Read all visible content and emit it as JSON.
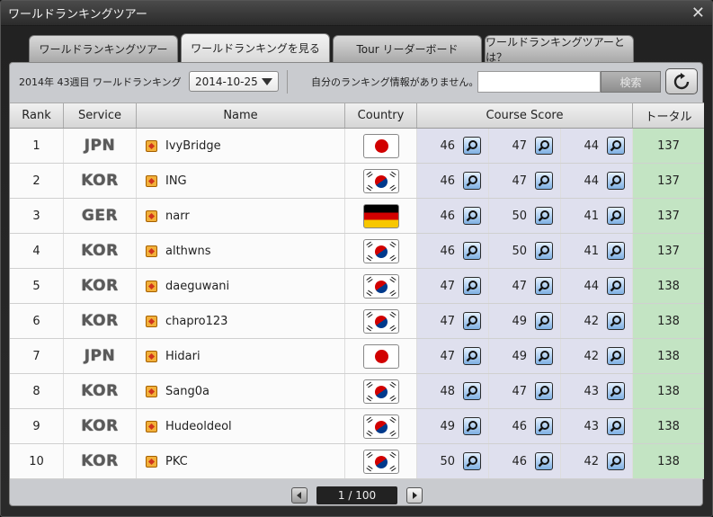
{
  "window": {
    "title": "ワールドランキングツアー"
  },
  "tabs": [
    {
      "label": "ワールドランキングツアー",
      "active": false
    },
    {
      "label": "ワールドランキングを見る",
      "active": true
    },
    {
      "label": "Tour リーダーボード",
      "active": false
    },
    {
      "label": "ワールドランキングツアーとは？",
      "active": false
    }
  ],
  "controls": {
    "week_label": "2014年 43週目 ワールドランキング",
    "selected_date": "2014-10-25",
    "my_info": "自分のランキング情報がありません。",
    "search_value": "",
    "search_label": "検索"
  },
  "headers": {
    "rank": "Rank",
    "service": "Service",
    "name": "Name",
    "country": "Country",
    "course_score": "Course Score",
    "total": "トータル"
  },
  "rows": [
    {
      "rank": "1",
      "service": "JPN",
      "name": "IvyBridge",
      "country": "jpn",
      "scores": [
        "46",
        "47",
        "44"
      ],
      "total": "137"
    },
    {
      "rank": "2",
      "service": "KOR",
      "name": "ING",
      "country": "kor",
      "scores": [
        "46",
        "47",
        "44"
      ],
      "total": "137"
    },
    {
      "rank": "3",
      "service": "GER",
      "name": "narr",
      "country": "ger",
      "scores": [
        "46",
        "50",
        "41"
      ],
      "total": "137"
    },
    {
      "rank": "4",
      "service": "KOR",
      "name": "althwns",
      "country": "kor",
      "scores": [
        "46",
        "50",
        "41"
      ],
      "total": "137"
    },
    {
      "rank": "5",
      "service": "KOR",
      "name": "daeguwani",
      "country": "kor",
      "scores": [
        "47",
        "47",
        "44"
      ],
      "total": "138"
    },
    {
      "rank": "6",
      "service": "KOR",
      "name": "chapro123",
      "country": "kor",
      "scores": [
        "47",
        "49",
        "42"
      ],
      "total": "138"
    },
    {
      "rank": "7",
      "service": "JPN",
      "name": "Hidari",
      "country": "jpn",
      "scores": [
        "47",
        "49",
        "42"
      ],
      "total": "138"
    },
    {
      "rank": "8",
      "service": "KOR",
      "name": "Sang0a",
      "country": "kor",
      "scores": [
        "48",
        "47",
        "43"
      ],
      "total": "138"
    },
    {
      "rank": "9",
      "service": "KOR",
      "name": "Hudeoldeol",
      "country": "kor",
      "scores": [
        "49",
        "46",
        "43"
      ],
      "total": "138"
    },
    {
      "rank": "10",
      "service": "KOR",
      "name": "PKC",
      "country": "kor",
      "scores": [
        "50",
        "46",
        "42"
      ],
      "total": "138"
    }
  ],
  "pager": {
    "label": "1 / 100"
  }
}
